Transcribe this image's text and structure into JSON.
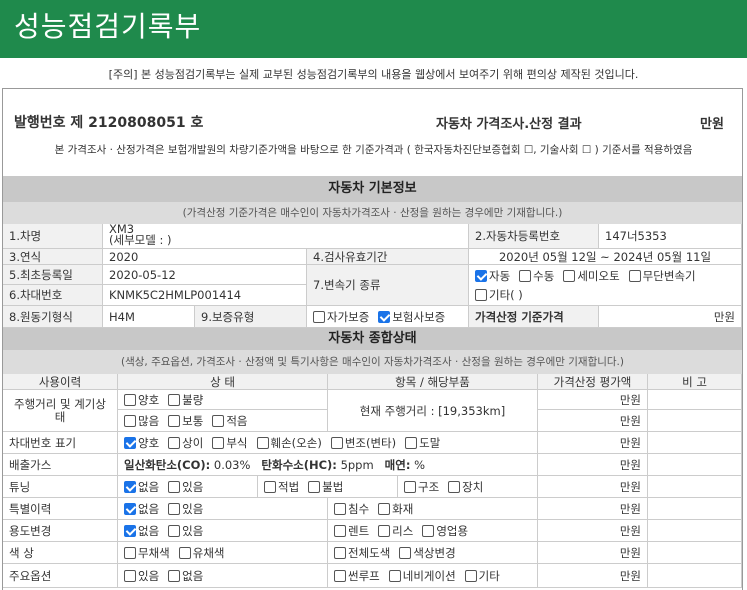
{
  "header": {
    "title": "성능점검기록부"
  },
  "notice": "[주의] 본 성능점검기록부는 실제 교부된 성능점검기록부의 내용을 웹상에서 보여주기 위해 편의상 제작된 것입니다.",
  "issue": {
    "prefix": "발행번호 제",
    "number": "2120808051",
    "suffix": "호"
  },
  "result_title": "자동차 가격조사.산정 결과",
  "won": "만원",
  "desc": "본 가격조사 · 산정가격은 보험개발원의 차량기준가액을 바탕으로 한 기준가격과 ( 한국자동차진단보증협회 ☐, 기술사회 ☐ ) 기준서를 적용하였음",
  "basic": {
    "title": "자동차 기본정보",
    "subtitle": "(가격산정 기준가격은 매수인이 자동차가격조사 · 산정을 원하는 경우에만 기재합니다.)",
    "name_label": "1.차명",
    "name_value": "XM3",
    "name_detail": "(세부모델 : )",
    "reg_label": "2.자동차등록번호",
    "reg_value": "147너5353",
    "year_label": "3.연식",
    "year_value": "2020",
    "valid_label": "4.검사유효기간",
    "valid_value": "2020년 05월 12일 ~ 2024년 05월 11일",
    "first_label": "5.최초등록일",
    "first_value": "2020-05-12",
    "trans_label": "7.변속기 종류",
    "trans_opts": [
      "자동",
      "수동",
      "세미오토",
      "무단변속기",
      "기타( )"
    ],
    "vin_label": "6.차대번호",
    "vin_value": "KNMK5C2HMLP001414",
    "engine_label": "8.원동기형식",
    "engine_value": "H4M",
    "warranty_label": "9.보증유형",
    "warranty_opts": [
      "자가보증",
      "보험사보증"
    ],
    "base_price_label": "가격산정 기준가격",
    "base_price_unit": "만원"
  },
  "overall": {
    "title": "자동차 종합상태",
    "subtitle": "(색상, 주요옵션, 가격조사 · 산정액 및 특기사항은 매수인이 자동차가격조사 · 산정을 원하는 경우에만 기재합니다.)",
    "headers": [
      "사용이력",
      "상 태",
      "항목 / 해당부품",
      "가격산정 평가액",
      "비 고"
    ],
    "mileage_label": "주행거리 및 계기상태",
    "mileage_opts1": [
      "양호",
      "불량"
    ],
    "mileage_opts2": [
      "많음",
      "보통",
      "적음"
    ],
    "mileage_text": "현재 주행거리 : [19,353km]",
    "vin_mark_label": "차대번호 표기",
    "vin_mark_opts": [
      "양호",
      "상이",
      "부식",
      "훼손(오손)",
      "변조(변타)",
      "도말"
    ],
    "emission_label": "배출가스",
    "emission_co": "일산화탄소(CO):",
    "emission_co_val": "0.03%",
    "emission_hc": "탄화수소(HC):",
    "emission_hc_val": "5ppm",
    "emission_smoke": "매연:",
    "emission_smoke_val": "%",
    "tuning_label": "튜닝",
    "tuning_opts": [
      "없음",
      "있음"
    ],
    "tuning_opts2": [
      "적법",
      "불법"
    ],
    "tuning_opts3": [
      "구조",
      "장치"
    ],
    "history_label": "특별이력",
    "history_opts": [
      "없음",
      "있음"
    ],
    "history_opts2": [
      "침수",
      "화재"
    ],
    "usage_label": "용도변경",
    "usage_opts": [
      "없음",
      "있음"
    ],
    "usage_opts2": [
      "렌트",
      "리스",
      "영업용"
    ],
    "color_label": "색 상",
    "color_opts": [
      "무채색",
      "유채색"
    ],
    "color_opts2": [
      "전체도색",
      "색상변경"
    ],
    "option_label": "주요옵션",
    "option_opts": [
      "있음",
      "없음"
    ],
    "option_opts2": [
      "썬루프",
      "네비게이션",
      "기타"
    ],
    "unit": "만원"
  },
  "accent_color": "#1f8a4c",
  "checkbox_color": "#1a73e8"
}
